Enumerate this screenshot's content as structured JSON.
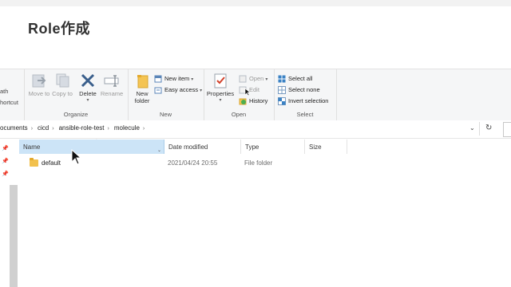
{
  "slide": {
    "title": "Role作成"
  },
  "ribbon": {
    "clipboard_partial": {
      "path_label": "ath",
      "shortcut_label": "hortcut"
    },
    "organize": {
      "label": "Organize",
      "move_to": "Move to",
      "copy_to": "Copy to",
      "delete": "Delete",
      "rename": "Rename"
    },
    "new": {
      "label": "New",
      "new_folder": "New folder",
      "new_item": "New item",
      "easy_access": "Easy access"
    },
    "open": {
      "label": "Open",
      "properties": "Properties",
      "open": "Open",
      "edit": "Edit",
      "history": "History"
    },
    "select": {
      "label": "Select",
      "select_all": "Select all",
      "select_none": "Select none",
      "invert_selection": "Invert selection"
    }
  },
  "address": {
    "crumbs": [
      "ocuments",
      "cicd",
      "ansible-role-test",
      "molecule"
    ]
  },
  "columns": {
    "name": "Name",
    "date_modified": "Date modified",
    "type": "Type",
    "size": "Size"
  },
  "files": [
    {
      "name": "default",
      "date_modified": "2021/04/24 20:55",
      "type": "File folder",
      "size": ""
    }
  ],
  "colors": {
    "accent_blue": "#2b79c2",
    "delete_blue": "#3a5f8c",
    "header_highlight": "#cce4f7",
    "folder_yellow": "#f2c14e"
  },
  "icons": {
    "move_to": "move-to-icon",
    "copy_to": "copy-to-icon",
    "delete": "delete-x-icon",
    "rename": "rename-icon",
    "new_folder": "new-folder-icon",
    "new_item": "new-item-icon",
    "easy_access": "easy-access-icon",
    "properties": "properties-check-icon",
    "open": "open-icon",
    "edit": "edit-icon",
    "history": "history-icon",
    "select_all": "select-all-icon",
    "select_none": "select-none-icon",
    "invert_selection": "invert-selection-icon",
    "folder": "folder-icon",
    "refresh": "refresh-icon",
    "dropdown": "chevron-down-icon",
    "pin": "pin-icon"
  }
}
